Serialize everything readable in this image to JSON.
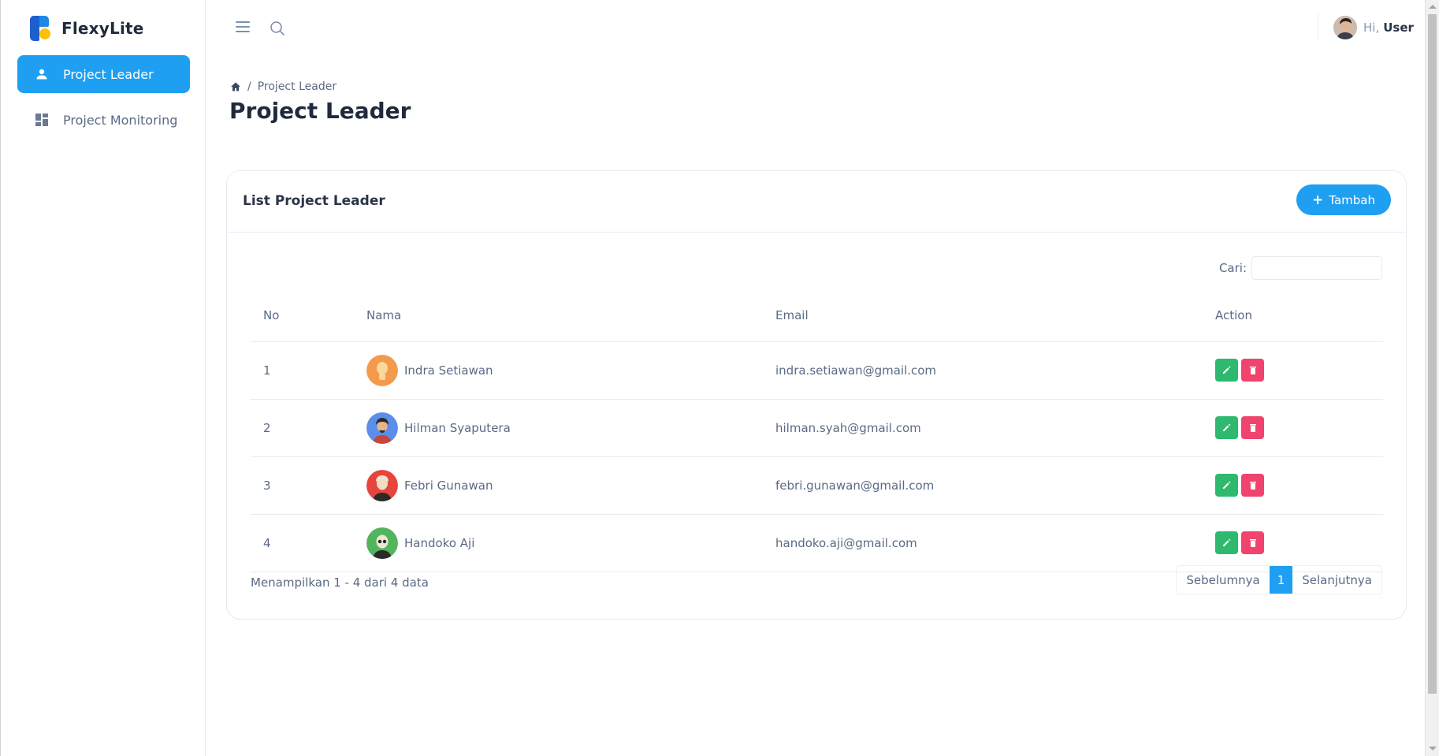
{
  "brand": {
    "name": "FlexyLite"
  },
  "sidebar": {
    "items": [
      {
        "label": "Project Leader",
        "icon": "user-icon",
        "active": true
      },
      {
        "label": "Project Monitoring",
        "icon": "dashboard-icon",
        "active": false
      }
    ]
  },
  "topbar": {
    "greeting": "Hi,",
    "user_name": "User"
  },
  "breadcrumb": {
    "current": "Project Leader"
  },
  "page": {
    "title": "Project Leader"
  },
  "card": {
    "title": "List Project Leader",
    "add_button": "Tambah",
    "search_label": "Cari:",
    "search_value": ""
  },
  "table": {
    "headers": [
      "No",
      "Nama",
      "Email",
      "Action"
    ],
    "rows": [
      {
        "no": "1",
        "nama": "Indra Setiawan",
        "email": "indra.setiawan@gmail.com",
        "avatar": "orange"
      },
      {
        "no": "2",
        "nama": "Hilman Syaputera",
        "email": "hilman.syah@gmail.com",
        "avatar": "blue"
      },
      {
        "no": "3",
        "nama": "Febri Gunawan",
        "email": "febri.gunawan@gmail.com",
        "avatar": "red"
      },
      {
        "no": "4",
        "nama": "Handoko Aji",
        "email": "handoko.aji@gmail.com",
        "avatar": "green"
      }
    ]
  },
  "footer": {
    "info": "Menampilkan 1 - 4 dari 4 data",
    "prev": "Sebelumnya",
    "page": "1",
    "next": "Selanjutnya"
  },
  "colors": {
    "primary": "#1e9ff2",
    "edit": "#2fb96f",
    "delete": "#f0436d",
    "avatar_orange": "#f39a4c",
    "avatar_blue": "#5a8ee8",
    "avatar_red": "#e5453d",
    "avatar_green": "#53b45e"
  }
}
